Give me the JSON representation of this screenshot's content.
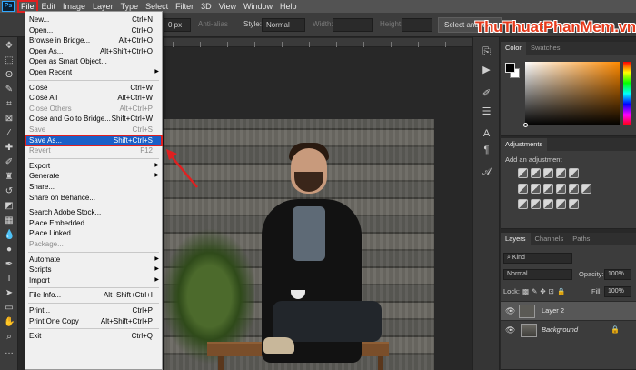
{
  "menubar": {
    "logo": "Ps",
    "items": [
      "File",
      "Edit",
      "Image",
      "Layer",
      "Type",
      "Select",
      "Filter",
      "3D",
      "View",
      "Window",
      "Help"
    ]
  },
  "options": {
    "px_value": "0 px",
    "anti_alias": "Anti-alias",
    "style_label": "Style:",
    "style_value": "Normal",
    "width_label": "Width:",
    "height_label": "Height:",
    "select_mask": "Select and Ma"
  },
  "watermark": {
    "name": "ThuThuatPhanMem",
    "tld": ".vn"
  },
  "file_menu": {
    "groups": [
      [
        {
          "label": "New...",
          "shortcut": "Ctrl+N"
        },
        {
          "label": "Open...",
          "shortcut": "Ctrl+O"
        },
        {
          "label": "Browse in Bridge...",
          "shortcut": "Alt+Ctrl+O"
        },
        {
          "label": "Open As...",
          "shortcut": "Alt+Shift+Ctrl+O"
        },
        {
          "label": "Open as Smart Object...",
          "shortcut": ""
        },
        {
          "label": "Open Recent",
          "shortcut": "",
          "submenu": true
        }
      ],
      [
        {
          "label": "Close",
          "shortcut": "Ctrl+W"
        },
        {
          "label": "Close All",
          "shortcut": "Alt+Ctrl+W"
        },
        {
          "label": "Close Others",
          "shortcut": "Alt+Ctrl+P",
          "disabled": true
        },
        {
          "label": "Close and Go to Bridge...",
          "shortcut": "Shift+Ctrl+W"
        },
        {
          "label": "Save",
          "shortcut": "Ctrl+S",
          "disabled": true
        },
        {
          "label": "Save As...",
          "shortcut": "Shift+Ctrl+S",
          "highlighted": true
        },
        {
          "label": "Revert",
          "shortcut": "F12",
          "disabled": true
        }
      ],
      [
        {
          "label": "Export",
          "shortcut": "",
          "submenu": true
        },
        {
          "label": "Generate",
          "shortcut": "",
          "submenu": true
        },
        {
          "label": "Share...",
          "shortcut": ""
        },
        {
          "label": "Share on Behance...",
          "shortcut": ""
        }
      ],
      [
        {
          "label": "Search Adobe Stock...",
          "shortcut": ""
        },
        {
          "label": "Place Embedded...",
          "shortcut": ""
        },
        {
          "label": "Place Linked...",
          "shortcut": ""
        },
        {
          "label": "Package...",
          "shortcut": "",
          "disabled": true
        }
      ],
      [
        {
          "label": "Automate",
          "shortcut": "",
          "submenu": true
        },
        {
          "label": "Scripts",
          "shortcut": "",
          "submenu": true
        },
        {
          "label": "Import",
          "shortcut": "",
          "submenu": true
        }
      ],
      [
        {
          "label": "File Info...",
          "shortcut": "Alt+Shift+Ctrl+I"
        }
      ],
      [
        {
          "label": "Print...",
          "shortcut": "Ctrl+P"
        },
        {
          "label": "Print One Copy",
          "shortcut": "Alt+Shift+Ctrl+P"
        }
      ],
      [
        {
          "label": "Exit",
          "shortcut": "Ctrl+Q"
        }
      ]
    ]
  },
  "color_panel": {
    "tabs": [
      "Color",
      "Swatches"
    ]
  },
  "adjustments_panel": {
    "title": "Adjustments",
    "subtitle": "Add an adjustment"
  },
  "layers_panel": {
    "tabs": [
      "Layers",
      "Channels",
      "Paths"
    ],
    "kind": "Kind",
    "blend_mode": "Normal",
    "opacity_label": "Opacity:",
    "opacity_value": "100%",
    "lock_label": "Lock:",
    "fill_label": "Fill:",
    "fill_value": "100%",
    "layers": [
      {
        "name": "Layer 2",
        "selected": true
      },
      {
        "name": "Background",
        "selected": false,
        "locked": true
      }
    ]
  },
  "colors": {
    "menu_highlight": "#1a5fc7",
    "callout_red": "#e02020",
    "accent": "#31a8ff"
  }
}
